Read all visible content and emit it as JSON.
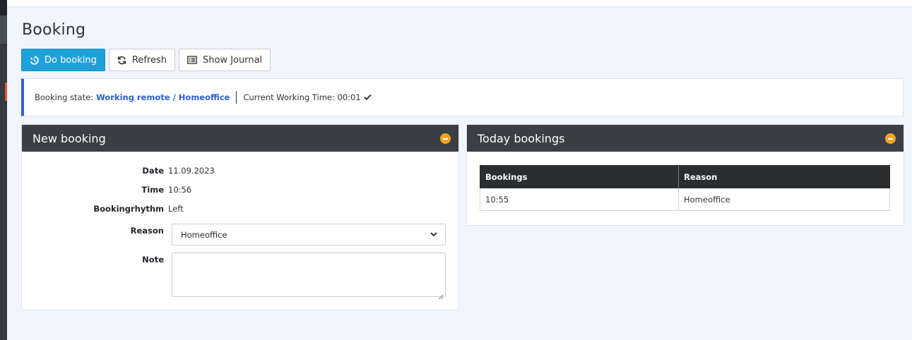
{
  "page": {
    "title": "Booking"
  },
  "toolbar": {
    "do_booking_label": "Do booking",
    "refresh_label": "Refresh",
    "show_journal_label": "Show Journal"
  },
  "state_bar": {
    "state_label": "Booking state:",
    "state_value": "Working remote / Homeoffice",
    "working_time_label": "Current Working Time: 00:01"
  },
  "new_booking": {
    "title": "New booking",
    "fields": {
      "date": {
        "label": "Date",
        "value": "11.09.2023"
      },
      "time": {
        "label": "Time",
        "value": "10:56"
      },
      "rhythm": {
        "label": "Bookingrhythm",
        "value": "Left"
      },
      "reason": {
        "label": "Reason",
        "value": "Homeoffice"
      },
      "note": {
        "label": "Note",
        "value": ""
      }
    }
  },
  "today_bookings": {
    "title": "Today bookings",
    "columns": [
      "Bookings",
      "Reason"
    ],
    "rows": [
      [
        "10:55",
        "Homeoffice"
      ]
    ]
  },
  "colors": {
    "primary": "#1ea0d9",
    "state_accent": "#2c5fd9",
    "panel_header": "#3a3f44",
    "collapse_button": "#f5a623"
  },
  "icons": {
    "do_booking": "history-icon",
    "refresh": "sync-icon",
    "show_journal": "list-icon",
    "check": "check-icon",
    "collapse": "minus-circle-icon",
    "select": "chevron-down-icon"
  }
}
